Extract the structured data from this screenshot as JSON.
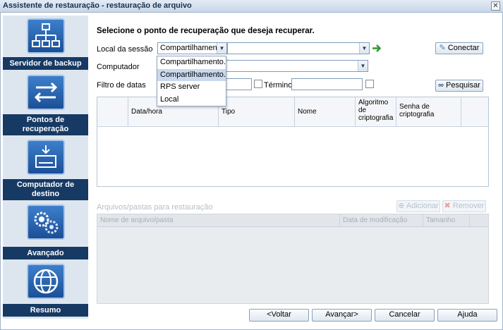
{
  "window": {
    "title": "Assistente de restauração - restauração de arquivo",
    "close_glyph": "✕"
  },
  "sidebar": {
    "items": [
      {
        "label": "Servidor de backup",
        "icon": "server-tree-icon"
      },
      {
        "label": "Pontos de recuperação",
        "icon": "arrows-icon"
      },
      {
        "label": "Computador de destino",
        "icon": "drive-icon"
      },
      {
        "label": "Avançado",
        "icon": "gears-icon"
      },
      {
        "label": "Resumo",
        "icon": "globe-icon"
      }
    ]
  },
  "main": {
    "heading": "Selecione o ponto de recuperação que deseja recuperar.",
    "session_label": "Local da sessão",
    "session_value": "Compartilhament",
    "connect_button": "Conectar",
    "computer_label": "Computador",
    "date_filter_label": "Filtro de datas",
    "end_label": "Término",
    "search_button": "Pesquisar",
    "table": {
      "columns": [
        "",
        "Data/hora",
        "Tipo",
        "Nome",
        "Algoritmo de criptografia",
        "Senha de criptografia"
      ]
    },
    "files_section_label": "Arquivos/pastas para restauração",
    "add_button": "Adicionar",
    "remove_button": "Remover",
    "files_table": {
      "columns": [
        "Nome de arquivo/pasta",
        "Data de modificação",
        "Tamanho"
      ]
    }
  },
  "dropdown": {
    "options": [
      "Compartilhamento...",
      "Compartilhamento...",
      "RPS server",
      "Local"
    ],
    "highlighted_index": 1
  },
  "footer": {
    "back": "<Voltar",
    "next": "Avançar>",
    "cancel": "Cancelar",
    "help": "Ajuda"
  }
}
